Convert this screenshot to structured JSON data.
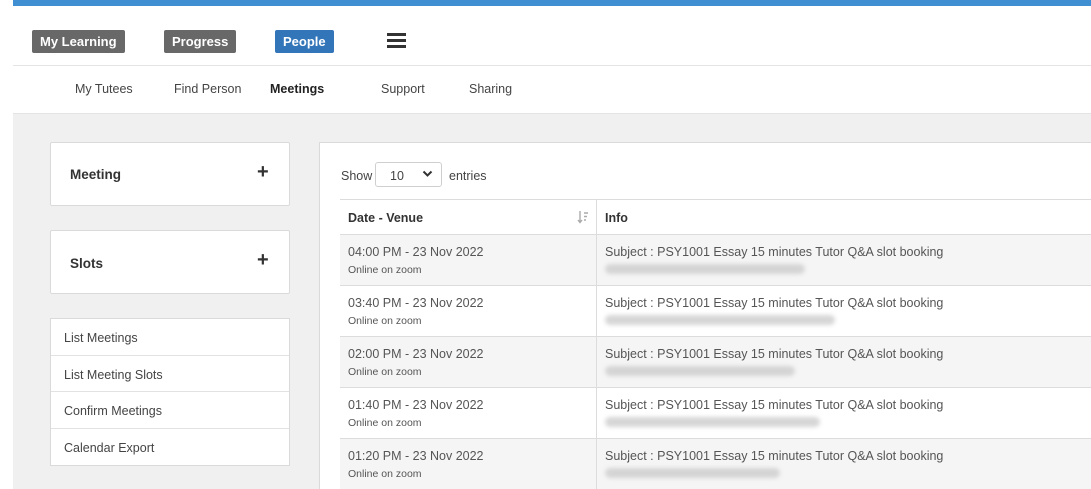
{
  "header": {
    "nav": [
      {
        "label": "My Learning",
        "style": "grey"
      },
      {
        "label": "Progress",
        "style": "grey"
      },
      {
        "label": "People",
        "style": "blue"
      }
    ],
    "accent_color": "#3f8fd2"
  },
  "subnav": {
    "items": [
      {
        "label": "My Tutees"
      },
      {
        "label": "Find Person"
      },
      {
        "label": "Meetings",
        "active": true
      },
      {
        "label": "Support"
      },
      {
        "label": "Sharing"
      }
    ]
  },
  "sidebar": {
    "meeting_label": "Meeting",
    "slots_label": "Slots",
    "plus_symbol": "+",
    "links": [
      "List Meetings",
      "List Meeting Slots",
      "Confirm Meetings",
      "Calendar Export"
    ]
  },
  "main": {
    "show_label": "Show",
    "entries_value": "10",
    "entries_label": "entries",
    "columns": [
      "Date - Venue",
      "Info"
    ],
    "rows": [
      {
        "date": "04:00 PM - 23 Nov 2022",
        "venue": "Online on zoom",
        "subject": "Subject : PSY1001 Essay 15 minutes Tutor Q&A slot booking"
      },
      {
        "date": "03:40 PM - 23 Nov 2022",
        "venue": "Online on zoom",
        "subject": "Subject : PSY1001 Essay 15 minutes Tutor Q&A slot booking"
      },
      {
        "date": "02:00 PM - 23 Nov 2022",
        "venue": "Online on zoom",
        "subject": "Subject : PSY1001 Essay 15 minutes Tutor Q&A slot booking"
      },
      {
        "date": "01:40 PM - 23 Nov 2022",
        "venue": "Online on zoom",
        "subject": "Subject : PSY1001 Essay 15 minutes Tutor Q&A slot booking"
      },
      {
        "date": "01:20 PM - 23 Nov 2022",
        "venue": "Online on zoom",
        "subject": "Subject : PSY1001 Essay 15 minutes Tutor Q&A slot booking"
      }
    ]
  }
}
